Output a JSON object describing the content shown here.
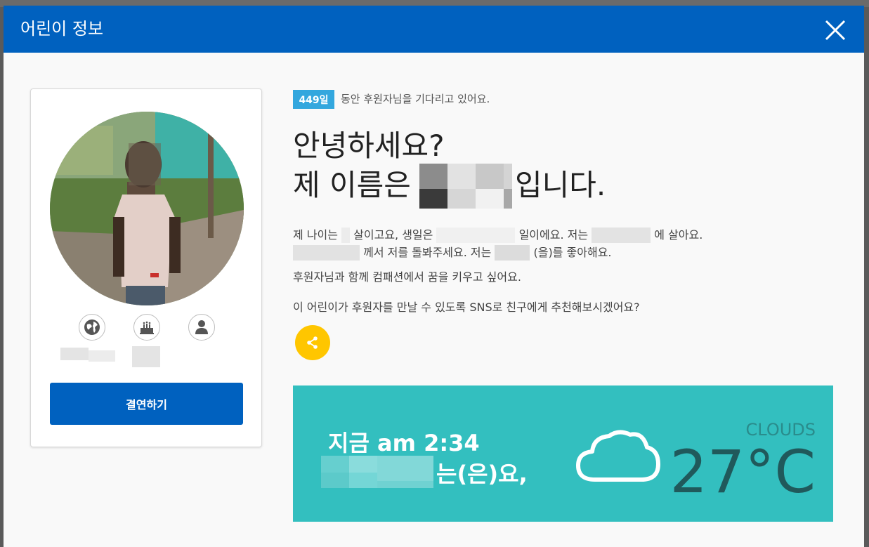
{
  "modal": {
    "title": "어린이 정보"
  },
  "card": {
    "icons": [
      "globe-icon",
      "birthday-cake-icon",
      "person-icon"
    ],
    "sponsor_label": "결연하기"
  },
  "wait": {
    "badge": "449일",
    "text": "동안 후원자님을 기다리고 있어요."
  },
  "greeting": {
    "line1": "안녕하세요?",
    "line2_prefix": "제 이름은",
    "line2_suffix": "입니다."
  },
  "intro": {
    "l1_a": "제 나이는",
    "l1_b": "살이고요, 생일은",
    "l1_c": "일이에요. 저는",
    "l1_d": "에 살아요.",
    "l2_a": "께서 저를 돌봐주세요. 저는",
    "l2_b": "(을)를 좋아해요.",
    "l3": "후원자님과 함께 컴패션에서 꿈을 키우고 싶어요.",
    "l4": "이 어린이가 후원자를 만날 수 있도록 SNS로 친구에게 추천해보시겠어요?"
  },
  "weather": {
    "time": "지금 am 2:34",
    "place_suffix": "는(은)요,",
    "condition": "CLOUDS",
    "temperature": "27°C"
  },
  "colors": {
    "header": "#0061bf",
    "badge": "#33a7de",
    "share": "#ffc600",
    "weather_bg": "#33bfbf"
  }
}
